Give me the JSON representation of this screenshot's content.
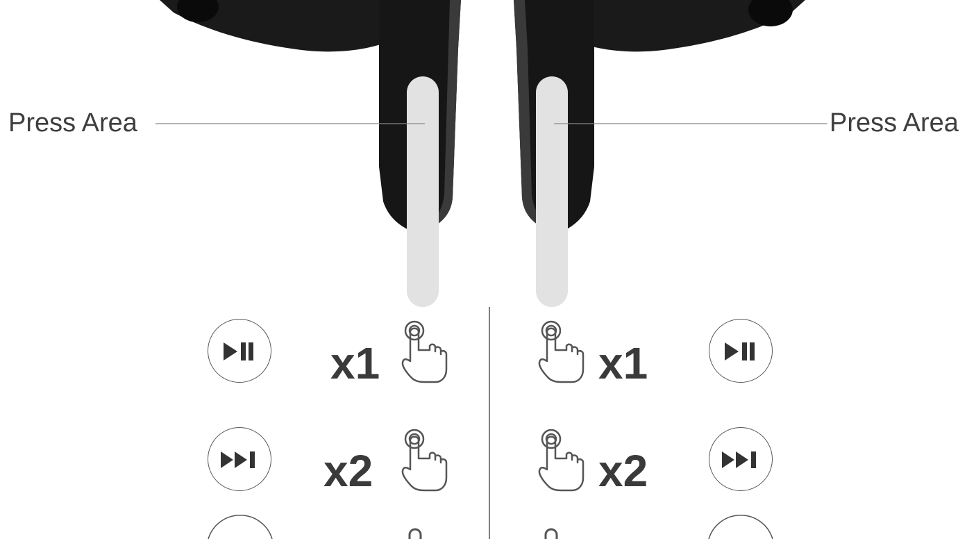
{
  "labels": {
    "left_press_area": "Press Area",
    "right_press_area": "Press Area"
  },
  "controls": {
    "left": [
      {
        "action_icon": "play-pause-icon",
        "multiplier": "x1"
      },
      {
        "action_icon": "next-track-icon",
        "multiplier": "x2"
      }
    ],
    "right": [
      {
        "action_icon": "play-pause-icon",
        "multiplier": "x1"
      },
      {
        "action_icon": "next-track-icon",
        "multiplier": "x2"
      }
    ]
  },
  "colors": {
    "earbud_body": "#161616",
    "press_area": "#e2e2e2",
    "text": "#3a3a3a",
    "line": "#888888"
  }
}
